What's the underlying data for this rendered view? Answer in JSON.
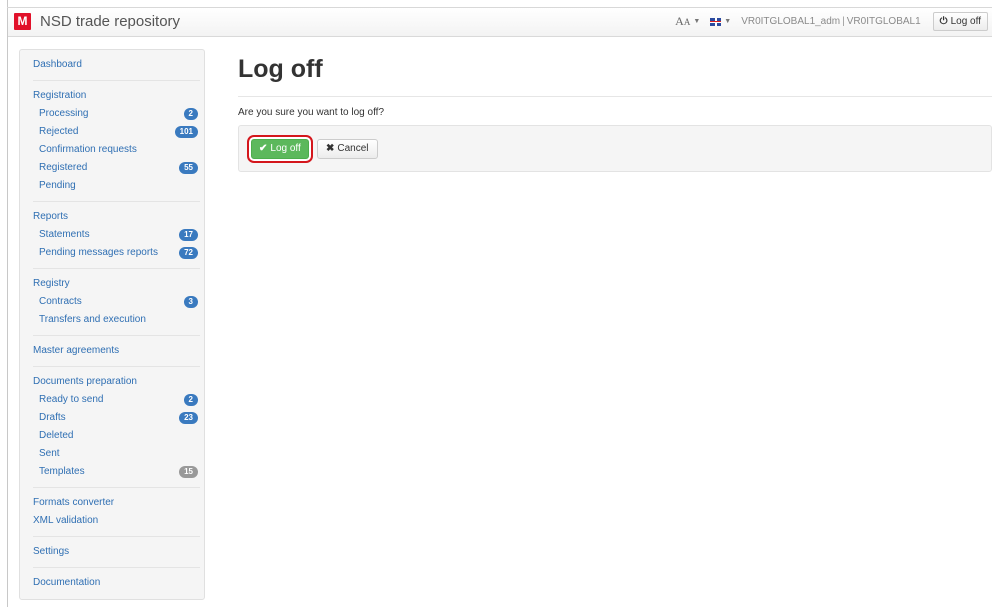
{
  "header": {
    "brand_logo": "M",
    "app_title": "NSD trade repository",
    "font_size_big": "A",
    "font_size_small": "A",
    "user_account": "VR0ITGLOBAL1_adm",
    "separator": "|",
    "organization": "VR0ITGLOBAL1",
    "logoff_label": "Log off",
    "icons": {
      "font": "font-size-icon",
      "lang": "uk-flag-icon",
      "power": "power-icon"
    }
  },
  "sidebar": {
    "dashboard": "Dashboard",
    "registration": {
      "title": "Registration",
      "items": [
        {
          "label": "Processing",
          "badge": "2"
        },
        {
          "label": "Rejected",
          "badge": "101"
        },
        {
          "label": "Confirmation requests"
        },
        {
          "label": "Registered",
          "badge": "55"
        },
        {
          "label": "Pending"
        }
      ]
    },
    "reports": {
      "title": "Reports",
      "items": [
        {
          "label": "Statements",
          "badge": "17"
        },
        {
          "label": "Pending messages reports",
          "badge": "72"
        }
      ]
    },
    "registry": {
      "title": "Registry",
      "items": [
        {
          "label": "Contracts",
          "badge": "3"
        },
        {
          "label": "Transfers and execution"
        }
      ]
    },
    "master_agreements": "Master agreements",
    "documents": {
      "title": "Documents preparation",
      "items": [
        {
          "label": "Ready to send",
          "badge": "2"
        },
        {
          "label": "Drafts",
          "badge": "23"
        },
        {
          "label": "Deleted"
        },
        {
          "label": "Sent"
        },
        {
          "label": "Templates",
          "badge": "15"
        }
      ]
    },
    "formats_converter": "Formats converter",
    "xml_validation": "XML validation",
    "settings": "Settings",
    "documentation": "Documentation"
  },
  "main": {
    "title": "Log off",
    "question": "Are you sure you want to log off?",
    "confirm_label": "Log off",
    "cancel_label": "Cancel",
    "icons": {
      "confirm": "check-icon",
      "cancel": "x-icon"
    },
    "colors": {
      "confirm": "#5cb85c",
      "highlight": "#d4161c",
      "badge": "#3a7abf"
    }
  }
}
